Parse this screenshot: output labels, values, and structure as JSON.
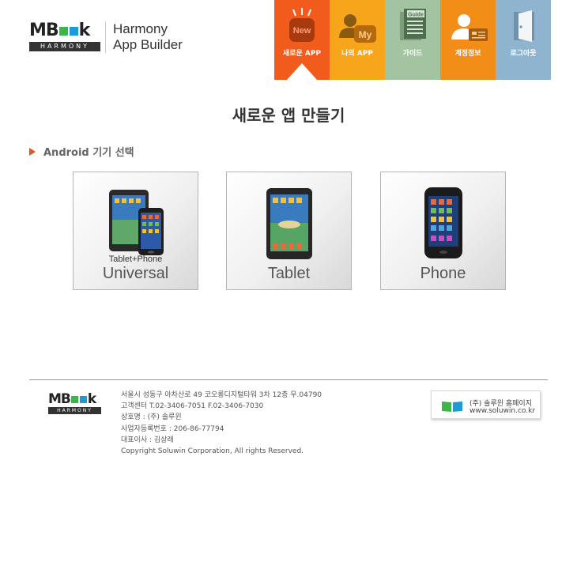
{
  "header": {
    "logo_word": "MBook",
    "logo_harmony": "HARMONY",
    "app_name_line1": "Harmony",
    "app_name_line2": "App Builder"
  },
  "nav": [
    {
      "label": "새로운 APP",
      "icon_text": "New",
      "icon": "new-app-icon",
      "active": true
    },
    {
      "label": "나의 APP",
      "icon_text": "My",
      "icon": "my-app-icon"
    },
    {
      "label": "가이드",
      "icon_text": "Guide",
      "icon": "guide-document-icon"
    },
    {
      "label": "계정정보",
      "icon": "account-person-icon"
    },
    {
      "label": "로그아웃",
      "icon": "logout-door-icon"
    }
  ],
  "page_title": "새로운 앱 만들기",
  "section_title": "Android 기기 선택",
  "devices": [
    {
      "sub": "Tablet+Phone",
      "main": "Universal",
      "icon": "tablet-phone-device-icon"
    },
    {
      "sub": "",
      "main": "Tablet",
      "icon": "tablet-device-icon"
    },
    {
      "sub": "",
      "main": "Phone",
      "icon": "phone-device-icon"
    }
  ],
  "footer": {
    "logo_word": "MBook",
    "logo_harmony": "HARMONY",
    "address": "서울시 성동구 아차산로 49 코오롱디지털타워 3차 12층 우.04790",
    "contact": "고객센터 T.02-3406-7051 F.02-3406-7030",
    "company": "상호명 : (주) 솔루윈",
    "biz_number": "사업자등록번호 : 206-86-77794",
    "ceo": "대표이사 : 김상래",
    "copyright": "Copyright Soluwin Corporation, All rights Reserved.",
    "homepage_label": "(주) 솔루윈 홈페이지",
    "homepage_url": "www.soluwin.co.kr"
  },
  "colors": {
    "nav_new": "#f15b1c",
    "nav_my": "#f7a51b",
    "nav_guide": "#a3c4a1",
    "nav_account": "#f28d17",
    "nav_logout": "#8fb4cf",
    "accent_triangle": "#e2551f",
    "book_green": "#3cb54a",
    "book_blue": "#1e9ad6"
  }
}
